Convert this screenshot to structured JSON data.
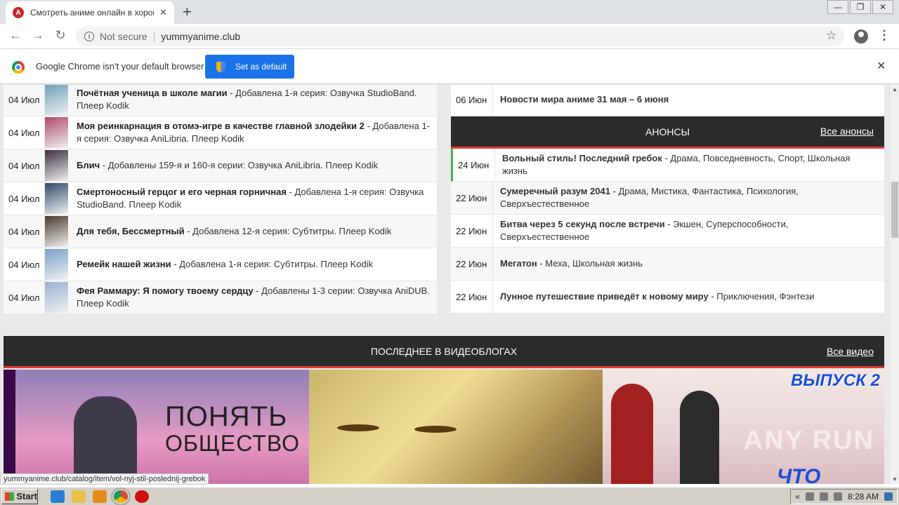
{
  "browser": {
    "tab_title": "Смотреть аниме онлайн в хороше",
    "not_secure": "Not secure",
    "url": "yummyanime.club",
    "infobar_text": "Google Chrome isn't your default browser",
    "set_default_label": "Set as default"
  },
  "left_list": [
    {
      "date": "04 Июл",
      "title": "Почётная ученица в школе магии",
      "desc": " - Добавлена 1-я серия: Озвучка StudioBand. Плеер Kodik",
      "thumb_color": "#6ba0b8"
    },
    {
      "date": "04 Июл",
      "title": "Моя реинкарнация в отомэ-игре в качестве главной злодейки 2",
      "desc": " - Добавлена 1-я серия: Озвучка AniLibria. Плеер Kodik",
      "thumb_color": "#b04a6a"
    },
    {
      "date": "04 Июл",
      "title": "Блич",
      "desc": " - Добавлены 159-я и 160-я серии: Озвучка AniLibria. Плеер Kodik",
      "thumb_color": "#3a3040"
    },
    {
      "date": "04 Июл",
      "title": "Смертоносный герцог и его черная горничная",
      "desc": " - Добавлена 1-я серия: Озвучка StudioBand. Плеер Kodik",
      "thumb_color": "#2d4a6a"
    },
    {
      "date": "04 Июл",
      "title": "Для тебя, Бессмертный",
      "desc": " - Добавлена 12-я серия: Субтитры. Плеер Kodik",
      "thumb_color": "#4a3a2a"
    },
    {
      "date": "04 Июл",
      "title": "Ремейк нашей жизни",
      "desc": " - Добавлена 1-я серия: Субтитры. Плеер Kodik",
      "thumb_color": "#7aa0c8"
    },
    {
      "date": "04 Июл",
      "title": "Фея Раммару: Я помогу твоему сердцу",
      "desc": " - Добавлены 1-3 серии: Озвучка AniDUB. Плеер Kodik",
      "thumb_color": "#9bb0d0"
    }
  ],
  "news": {
    "date": "06 Июн",
    "title": "Новости мира аниме 31 мая – 6 июня"
  },
  "announcements": {
    "header": "АНОНСЫ",
    "all_link": "Все анонсы",
    "items": [
      {
        "date": "24 Июн",
        "title": "Вольный стиль! Последний гребок",
        "desc": " - Драма, Повседневность, Спорт, Школьная жизнь"
      },
      {
        "date": "22 Июн",
        "title": "Сумеречный разум 2041",
        "desc": " - Драма, Мистика, Фантастика, Психология, Сверхъестественное"
      },
      {
        "date": "22 Июн",
        "title": "Битва через 5 секунд после встречи",
        "desc": " - Экшен, Суперспособности, Сверхъестественное"
      },
      {
        "date": "22 Июн",
        "title": "Мегатон",
        "desc": " - Меха, Школьная жизнь"
      },
      {
        "date": "22 Июн",
        "title": "Лунное путешествие приведёт к новому миру",
        "desc": " - Приключения, Фэнтези"
      }
    ]
  },
  "videoblogs": {
    "header": "ПОСЛЕДНЕЕ В ВИДЕОБЛОГАХ",
    "all_link": "Все видео",
    "v1_line1": "ПОНЯТЬ",
    "v1_line2": "ОБЩЕСТВО",
    "v3_top": "ВЫПУСК 2",
    "v3_bottom": "ЧТО",
    "watermark": "ANY RUN"
  },
  "status_url": "yummyanime.club/catalog/item/vol-nyj-stil-poslednij-grebok",
  "taskbar": {
    "start": "Start",
    "time": "8:28 AM"
  },
  "colors": {
    "accent_red": "#e53935",
    "dark_header": "#2b2b2b",
    "chrome_blue": "#1a73e8"
  }
}
